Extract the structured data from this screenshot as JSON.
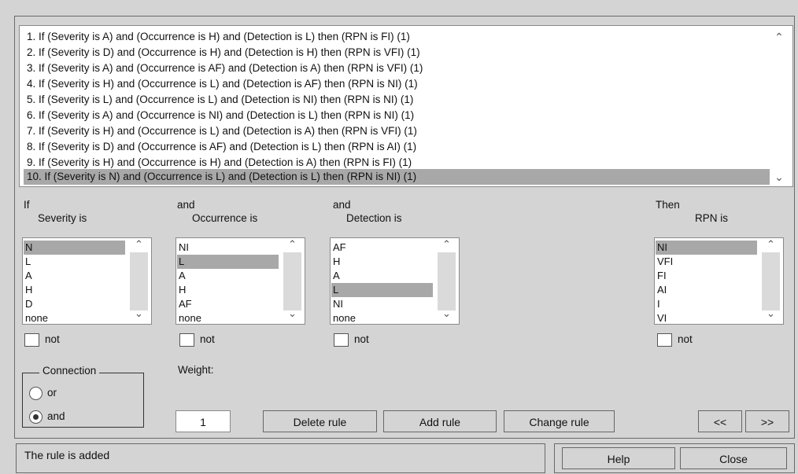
{
  "rules": [
    "1. If (Severity is A) and (Occurrence is H) and (Detection is L) then (RPN is FI) (1)",
    "2. If (Severity is D) and (Occurrence is H) and (Detection is H) then (RPN is VFI) (1)",
    "3. If (Severity is A) and (Occurrence is AF) and (Detection is A) then (RPN is VFI) (1)",
    "4. If (Severity is H) and (Occurrence is L) and (Detection is AF) then (RPN is NI) (1)",
    "5. If (Severity is L) and (Occurrence is L) and (Detection is NI) then (RPN is NI) (1)",
    "6. If (Severity is A) and (Occurrence is NI) and (Detection is L) then (RPN is NI) (1)",
    "7. If (Severity is H) and (Occurrence is L) and (Detection is A) then (RPN is VFI) (1)",
    "8. If (Severity is D) and (Occurrence is AF) and (Detection is L) then (RPN is AI) (1)",
    "9. If (Severity is H) and (Occurrence is H) and (Detection is A) then (RPN is FI) (1)",
    "10. If (Severity is N) and (Occurrence is L) and (Detection is L) then (RPN is NI) (1)"
  ],
  "selected_rule_index": 9,
  "severity": {
    "prefix": "If",
    "title": "Severity is",
    "options": [
      "N",
      "L",
      "A",
      "H",
      "D",
      "none"
    ],
    "selected": 0,
    "not_label": "not"
  },
  "occurrence": {
    "prefix": "and",
    "title": "Occurrence is",
    "options": [
      "NI",
      "L",
      "A",
      "H",
      "AF",
      "none"
    ],
    "selected": 1,
    "not_label": "not"
  },
  "detection": {
    "prefix": "and",
    "title": "Detection is",
    "options": [
      "AF",
      "H",
      "A",
      "L",
      "NI",
      "none"
    ],
    "selected": 3,
    "not_label": "not"
  },
  "rpn": {
    "prefix": "Then",
    "title": "RPN is",
    "options": [
      "NI",
      "VFI",
      "FI",
      "AI",
      "I",
      "VI"
    ],
    "selected": 0,
    "not_label": "not"
  },
  "connection": {
    "title": "Connection",
    "or_label": "or",
    "and_label": "and",
    "selected": "and"
  },
  "weight": {
    "label": "Weight:",
    "value": "1"
  },
  "buttons": {
    "delete": "Delete rule",
    "add": "Add rule",
    "change": "Change rule",
    "prev": "<<",
    "next": ">>",
    "help": "Help",
    "close": "Close"
  },
  "status": "The rule is added",
  "icons": {
    "scroll_up": "chevron-up-icon",
    "scroll_down": "chevron-down-icon"
  }
}
